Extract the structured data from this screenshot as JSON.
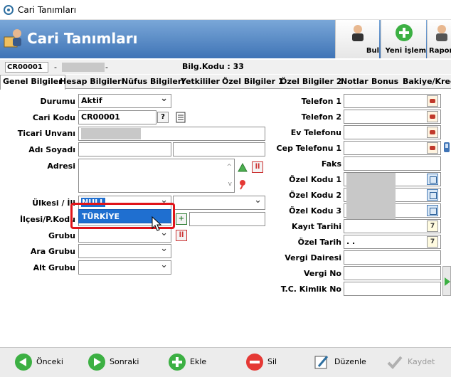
{
  "window": {
    "title": "Cari Tanımları"
  },
  "banner": {
    "title": "Cari Tanımları"
  },
  "toolbar": {
    "bul": "Bul",
    "yeni": "Yeni İşlem",
    "rapor": "Raporla"
  },
  "info": {
    "code": "CR00001",
    "dash1": "-",
    "dash2": "-",
    "bilg": "Bilg.Kodu : 33"
  },
  "tabs": [
    "Genel Bilgiler",
    "Hesap Bilgileri",
    "Nüfus Bilgileri",
    "Yetkililer",
    "Özel Bilgiler 1",
    "Özel Bilgiler 2",
    "Notlar",
    "Bonus",
    "Bakiye/Kredi"
  ],
  "left": {
    "durumu_label": "Durumu",
    "durumu_value": "Aktif",
    "cari_kodu_label": "Cari Kodu",
    "cari_kodu_value": "CR00001",
    "cari_q": "?",
    "ticari_label": "Ticari Unvanı",
    "adsoyad_label": "Adı Soyadı",
    "adres_label": "Adresi",
    "ulkesi_label": "Ülkesi / İli",
    "ulkesi_value": "NULL",
    "ilce_label": "İlçesi/P.Kodu",
    "grubu_label": "Grubu",
    "ara_grubu_label": "Ara Grubu",
    "alt_grubu_label": "Alt Grubu"
  },
  "dropdown": {
    "option": "TÜRKİYE"
  },
  "right": {
    "tel1": "Telefon 1",
    "tel2": "Telefon 2",
    "evtel": "Ev Telefonu",
    "cep": "Cep Telefonu 1",
    "faks": "Faks",
    "ozel1": "Özel Kodu 1",
    "ozel2": "Özel Kodu 2",
    "ozel3": "Özel Kodu 3",
    "kayit": "Kayıt Tarihi",
    "ozeltarih": "Özel Tarih",
    "ozeltarih_value": ". .",
    "vergid": "Vergi Dairesi",
    "vergino": "Vergi No",
    "tckimlik": "T.C. Kimlik No"
  },
  "bottom": {
    "onceki": "Önceki",
    "sonraki": "Sonraki",
    "ekle": "Ekle",
    "sil": "Sil",
    "duzenle": "Düzenle",
    "kaydet": "Kaydet"
  },
  "colors": {
    "banner": "#3f74b6",
    "highlight": "#1f6fd0",
    "callout": "#e0141a"
  }
}
